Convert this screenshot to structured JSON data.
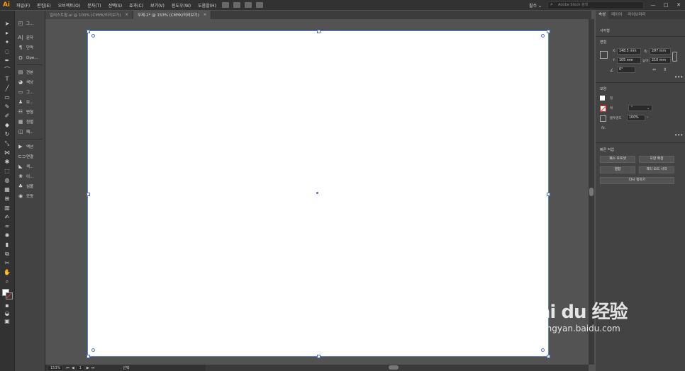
{
  "menubar": {
    "logo": "Ai",
    "items": [
      "파일(F)",
      "편집(E)",
      "오브젝트(O)",
      "문자(T)",
      "선택(S)",
      "효과(C)",
      "보기(V)",
      "윈도우(W)",
      "도움말(H)"
    ],
    "workspace": "필수 ⌄",
    "stock_search_placeholder": "Adobe Stock 검색"
  },
  "tabs": [
    {
      "label": "일러스트할.ai @ 100% (CMYK/미리보기)",
      "close": "×"
    },
    {
      "label": "무제-2* @ 153% (CMYK/미리보기)",
      "close": "×"
    }
  ],
  "panel2": {
    "group1": [
      {
        "icon": "◰",
        "label": "그..."
      },
      {
        "icon": "A|",
        "label": "문자"
      },
      {
        "icon": "¶",
        "label": "단락"
      },
      {
        "icon": "O",
        "label": "Ope..."
      }
    ],
    "group2": [
      {
        "icon": "▤",
        "label": "견본"
      },
      {
        "icon": "◕",
        "label": "색상"
      },
      {
        "icon": "▭",
        "label": "그..."
      },
      {
        "icon": "♟",
        "label": "브..."
      },
      {
        "icon": "☷",
        "label": "변형"
      },
      {
        "icon": "▦",
        "label": "정렬"
      },
      {
        "icon": "◫",
        "label": "패..."
      }
    ],
    "group3": [
      {
        "icon": "▶",
        "label": "액션"
      },
      {
        "icon": "⊂⊃",
        "label": "연결"
      },
      {
        "icon": "◣",
        "label": "색..."
      },
      {
        "icon": "❀",
        "label": "이..."
      },
      {
        "icon": "♣",
        "label": "심볼"
      },
      {
        "icon": "◉",
        "label": "모양"
      }
    ]
  },
  "status": {
    "zoom": "153%",
    "page": "1",
    "tool": "선택"
  },
  "rightpanel": {
    "tabs": [
      "속성",
      "레이어",
      "라이브러리"
    ],
    "selection": "사각형",
    "transform": {
      "title": "변형",
      "x_label": "X:",
      "x": "148.5 mm",
      "y_label": "Y:",
      "y": "105 mm",
      "w_label": "폭:",
      "w": "297 mm",
      "h_label": "높이:",
      "h": "210 mm",
      "angle": "0°"
    },
    "appearance": {
      "title": "모양",
      "fill_label": "칠",
      "stroke_label": "획",
      "opacity_label": "불투명도",
      "opacity": "100%",
      "fx": "fx."
    },
    "quick": {
      "title": "빠른 작업",
      "buttons": [
        "패스 오프셋",
        "모양 확장",
        "결합",
        "격리 모드 시작",
        "결합",
        "다시 칠하기"
      ]
    },
    "more": "•••"
  },
  "watermark": {
    "main": "Bai du 经验",
    "sub": "jingyan.baidu.com"
  },
  "colors": {
    "accent": "#4a6fd0",
    "logo": "#ff9a00"
  }
}
